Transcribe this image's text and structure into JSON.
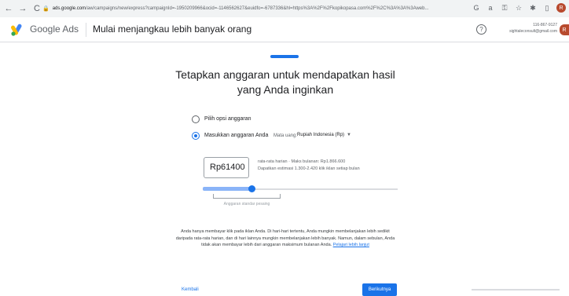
{
  "browser": {
    "url_host": "ads.google.com",
    "url_path": "/aw/campaigns/new/express?campaignId=-1950209966&ocid=-1146562627&euidfo=-6787336&hl=https%3A%2F%2Fkopikopasa.com%2F%2C%3A%3A%3Aweb...",
    "icons": [
      "back-icon",
      "forward-icon",
      "reload-icon",
      "lock-icon",
      "google-icon",
      "translate-icon",
      "key-icon",
      "star-icon",
      "extensions-icon",
      "sidebar-icon",
      "profile-icon"
    ]
  },
  "header": {
    "brand": "Google Ads",
    "page_title": "Mulai menjangkau lebih banyak orang",
    "account_id": "116-867-9127",
    "account_email": "sightaleconsult@gmail.com",
    "avatar_letter": "R"
  },
  "heading": {
    "line1": "Tetapkan anggaran untuk mendapatkan hasil",
    "line2": "yang Anda inginkan"
  },
  "options": {
    "option1": "Pilih opsi anggaran",
    "option2": "Masukkan anggaran Anda",
    "currency_label": "Mata uang:",
    "currency_value": "Rupiah Indonesia (Rp)"
  },
  "budget": {
    "value": "Rp61400",
    "line1": "rata-rata harian  ·  Maks bulanan: Rp1.866.600",
    "line2": "Dapatkan estimasi 1.300-2.420 klik iklan setiap bulan",
    "slider_caption": "Anggaran standar pesaing",
    "slider_level": 0.25
  },
  "info": {
    "text": "Anda hanya membayar klik pada iklan Anda. Di hari-hari tertentu, Anda mungkin membelanjakan lebih sedikit daripada rata-rata harian, dan di hari lainnya mungkin membelanjakan lebih banyak. Namun, dalam sebulan, Anda tidak akan membayar lebih dari anggaran maksimum bulanan Anda.",
    "link": "Pelajari lebih lanjut"
  },
  "footer": {
    "back": "Kembali",
    "next": "Berikutnya"
  },
  "colors": {
    "accent": "#1a73e8",
    "slider_fill": "#8ab4f8",
    "avatar": "#b84a2e"
  }
}
